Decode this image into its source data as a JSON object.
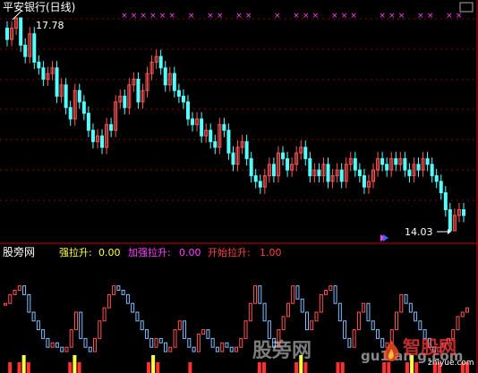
{
  "main_panel": {
    "title": "平安银行(日线)",
    "high_label": "17.78",
    "low_label": "14.03",
    "colors": {
      "up": "#ff5454",
      "down": "#54ffff",
      "grid": "#8a0000",
      "title": "#ffffff",
      "marker": "#ff40ff"
    }
  },
  "indicator_panel": {
    "name": "股旁网",
    "items": [
      {
        "label": "强拉升:",
        "value": "0.00",
        "color": "#ffff40"
      },
      {
        "label": "加强拉升:",
        "value": "0.00",
        "color": "#ff40ff"
      },
      {
        "label": "开始拉升:",
        "value": "1.00",
        "color": "#ff4040"
      }
    ]
  },
  "watermarks": {
    "text1": "股旁网",
    "text2": "gu1 an g.com",
    "logo_text": "智股网",
    "logo_url": "zhiyue.com"
  },
  "chart_data": {
    "type": "candlestick",
    "series_high": 17.78,
    "series_low": 14.03,
    "closes": [
      17.4,
      17.6,
      17.78,
      17.3,
      17.1,
      17.5,
      17.0,
      16.9,
      16.7,
      16.8,
      16.9,
      16.4,
      16.6,
      16.2,
      16.0,
      16.5,
      16.3,
      16.1,
      15.8,
      15.6,
      15.7,
      15.5,
      15.9,
      15.8,
      16.3,
      16.4,
      16.2,
      16.6,
      16.7,
      16.3,
      16.5,
      16.8,
      17.0,
      17.1,
      16.9,
      16.6,
      16.8,
      16.5,
      16.4,
      16.3,
      16.0,
      15.9,
      16.0,
      15.7,
      15.8,
      15.6,
      15.5,
      15.9,
      15.8,
      15.4,
      15.2,
      15.5,
      15.6,
      15.3,
      15.0,
      14.9,
      14.8,
      15.0,
      15.2,
      15.0,
      15.4,
      15.3,
      15.1,
      15.2,
      15.4,
      15.5,
      15.3,
      15.0,
      15.1,
      15.0,
      15.2,
      14.9,
      15.0,
      15.1,
      14.9,
      15.2,
      15.3,
      15.1,
      15.0,
      14.8,
      14.9,
      15.1,
      15.3,
      15.2,
      15.1,
      15.3,
      15.2,
      15.3,
      15.1,
      15.0,
      15.2,
      15.1,
      15.3,
      15.2,
      15.0,
      14.9,
      14.7,
      14.4,
      14.03,
      14.3,
      14.4,
      14.3
    ],
    "indicator_levels": [
      0.6,
      0.7,
      0.75,
      0.8,
      0.7,
      0.5,
      0.4,
      0.3,
      0.2,
      0.1,
      0.15,
      0.1,
      0.05,
      0.1,
      0.3,
      0.5,
      0.2,
      0.1,
      0.05,
      0.2,
      0.4,
      0.55,
      0.7,
      0.8,
      0.75,
      0.7,
      0.6,
      0.5,
      0.4,
      0.3,
      0.2,
      0.1,
      0.2,
      0.15,
      0.05,
      0.1,
      0.3,
      0.4,
      0.2,
      0.1,
      0.05,
      0.25,
      0.3,
      0.2,
      0.1,
      0.05,
      0.15,
      0.1,
      0.05,
      0.1,
      0.2,
      0.4,
      0.6,
      0.8,
      0.6,
      0.4,
      0.2,
      0.1,
      0.3,
      0.45,
      0.6,
      0.8,
      0.65,
      0.5,
      0.3,
      0.4,
      0.5,
      0.7,
      0.75,
      0.8,
      0.6,
      0.4,
      0.2,
      0.1,
      0.3,
      0.5,
      0.6,
      0.4,
      0.3,
      0.2,
      0.1,
      0.15,
      0.3,
      0.5,
      0.7,
      0.6,
      0.5,
      0.4,
      0.3,
      0.2,
      0.1,
      0.05,
      0.1,
      0.15,
      0.2,
      0.3,
      0.45,
      0.5,
      0.55
    ],
    "signal_bars": [
      0,
      1,
      0,
      1,
      2,
      1,
      0,
      0,
      0,
      0,
      0,
      0,
      0,
      0,
      1,
      2,
      1,
      0,
      0,
      0,
      0,
      0,
      0,
      0,
      0,
      0,
      0,
      0,
      0,
      0,
      0,
      1,
      2,
      1,
      0,
      0,
      0,
      0,
      0,
      0,
      1,
      0,
      0,
      0,
      0,
      0,
      0,
      0,
      0,
      0,
      0,
      0,
      0,
      0,
      0,
      1,
      1,
      0,
      0,
      0,
      0,
      0,
      0,
      1,
      2,
      1,
      0,
      0,
      0,
      0,
      0,
      0,
      1,
      1,
      0,
      0,
      0,
      0,
      0,
      0,
      0,
      0,
      1,
      1,
      0,
      0,
      0,
      1,
      2,
      1,
      0,
      0,
      0,
      1,
      1,
      0,
      0,
      0,
      0,
      1,
      1
    ],
    "marker_positions": [
      0.26,
      0.28,
      0.3,
      0.32,
      0.34,
      0.36,
      0.4,
      0.44,
      0.46,
      0.5,
      0.52,
      0.58,
      0.62,
      0.64,
      0.66,
      0.7,
      0.72,
      0.74,
      0.8,
      0.82,
      0.84,
      0.88,
      0.9,
      0.94,
      0.96
    ]
  }
}
